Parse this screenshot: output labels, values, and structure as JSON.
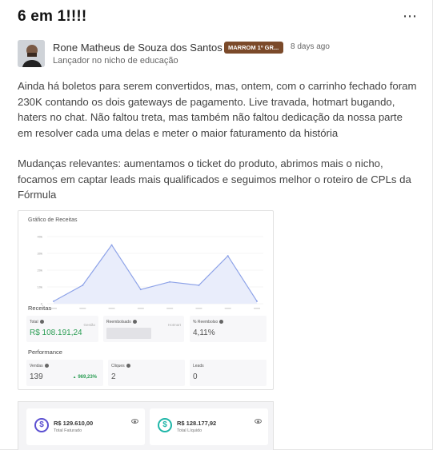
{
  "post": {
    "title": "6 em 1!!!!",
    "menu_icon": "more-horizontal-icon",
    "author": "Rone Matheus de Souza dos Santos",
    "badge": "MARROM 1º GR...",
    "time": "8 days ago",
    "role": "Lançador no nicho de educação",
    "paragraph1": "Ainda há boletos para serem convertidos, mas, ontem, com o carrinho fechado foram 230K contando os dois gateways de pagamento. Live travada, hotmart bugando, haters no chat. Não faltou treta, mas também não faltou dedicação da nossa parte em resolver cada uma delas e meter o maior faturamento da história",
    "paragraph2": "Mudanças relevantes: aumentamos o ticket do produto, abrimos mais o nicho, focamos em captar leads mais qualificados e seguimos melhor o roteiro de CPLs da Fórmula"
  },
  "dashboard": {
    "chart_title": "Gráfico de Receitas",
    "receitas_label": "Receitas",
    "performance_label": "Performance",
    "cards": {
      "total_label": "Total",
      "total_value": "R$ 108.191,24",
      "total_side": "Gestão",
      "reembolsado_label": "Reembolsado",
      "reembolsado_side": "Hotmart",
      "pct_label": "% Reembolso",
      "pct_value": "4,11%",
      "vendas_label": "Vendas",
      "vendas_value": "139",
      "vendas_growth": "969,23%",
      "cliques_label": "Cliques",
      "cliques_value": "2",
      "leads_label": "Leads",
      "leads_value": "0"
    },
    "summary": {
      "faturado_value": "R$ 129.610,00",
      "faturado_label": "Total Faturado",
      "liquido_value": "R$ 128.177,92",
      "liquido_label": "Total Líquido"
    },
    "colors": {
      "line": "#8ea3e8",
      "fill": "#e9edfb",
      "positive": "#2c9e55",
      "badge": "#7b4a2a",
      "faturado_icon": "#5b4fd1",
      "liquido_icon": "#1fb6a8"
    }
  },
  "chart_data": {
    "type": "area",
    "title": "Gráfico de Receitas",
    "x": [
      "",
      "",
      "",
      "",
      "",
      "",
      "",
      "",
      ""
    ],
    "values": [
      1500,
      11000,
      35000,
      8500,
      13000,
      11000,
      28500,
      1500
    ],
    "ylim": [
      0,
      40000
    ],
    "ytick_labels": [
      "0",
      "10k",
      "20k",
      "30k",
      "40k"
    ],
    "yticks": [
      0,
      10000,
      20000,
      30000,
      40000
    ],
    "grid": true
  }
}
